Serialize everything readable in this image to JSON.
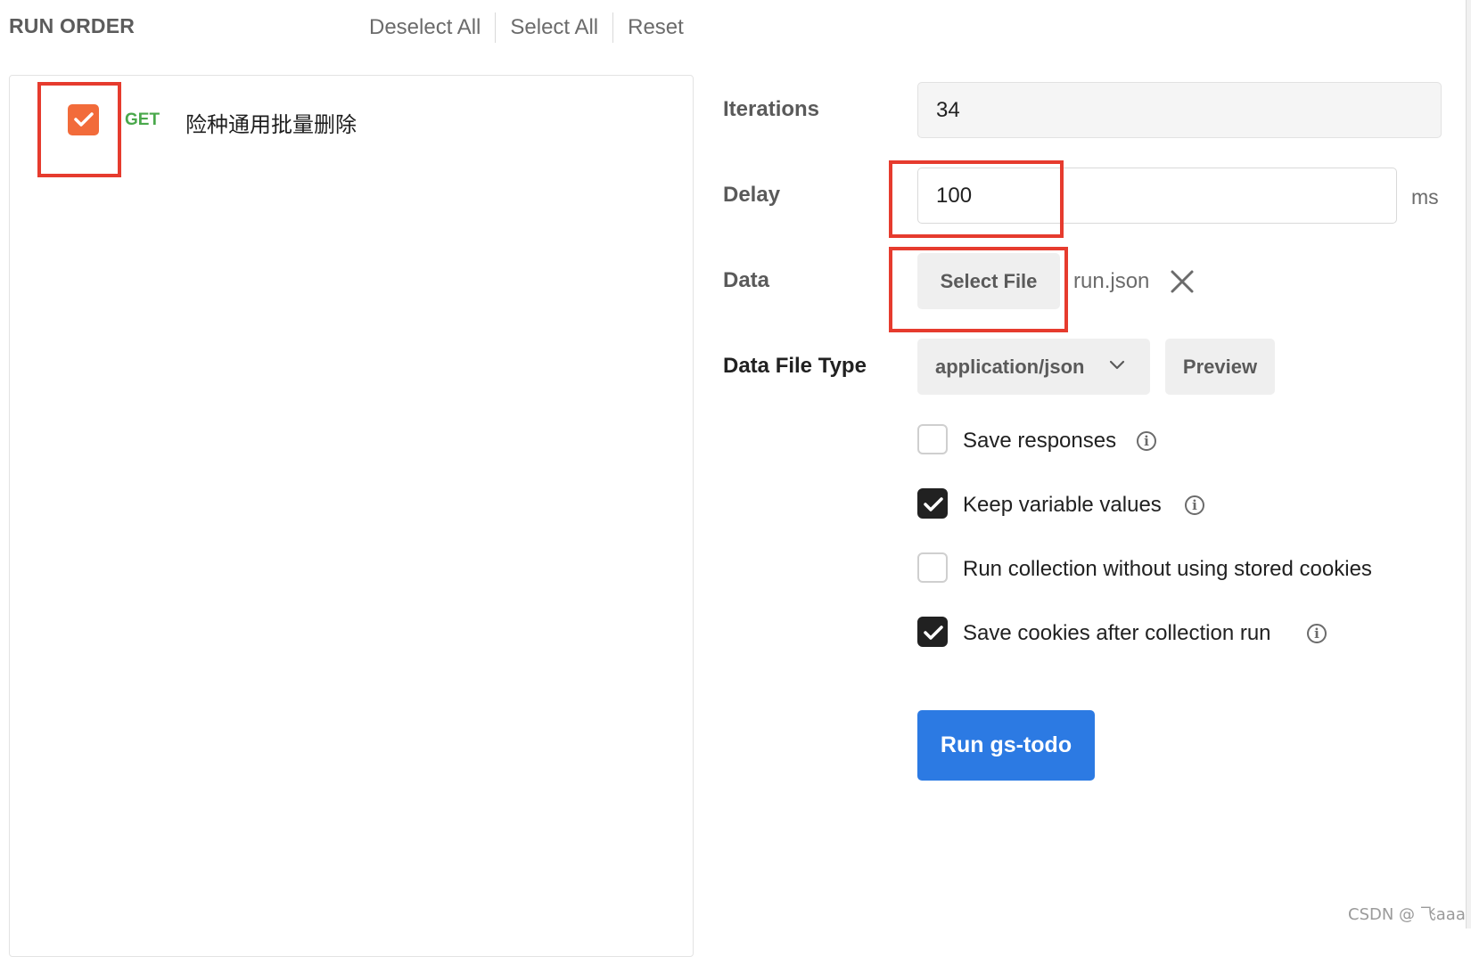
{
  "header": {
    "title": "RUN ORDER",
    "deselect_all": "Deselect All",
    "select_all": "Select All",
    "reset": "Reset"
  },
  "requests": [
    {
      "method": "GET",
      "name": "险种通用批量删除",
      "checked": true
    }
  ],
  "form": {
    "iterations_label": "Iterations",
    "iterations_value": "34",
    "delay_label": "Delay",
    "delay_value": "100",
    "delay_unit": "ms",
    "data_label": "Data",
    "select_file_label": "Select File",
    "file_name": "run.json",
    "data_file_type_label": "Data File Type",
    "data_file_type_value": "application/json",
    "preview_label": "Preview"
  },
  "options": [
    {
      "label": "Save responses",
      "checked": false,
      "has_info": true
    },
    {
      "label": "Keep variable values",
      "checked": true,
      "has_info": true
    },
    {
      "label": "Run collection without using stored cookies",
      "checked": false,
      "has_info": false
    },
    {
      "label": "Save cookies after collection run",
      "checked": true,
      "has_info": true
    }
  ],
  "run_button_label": "Run gs-todo",
  "watermark": "CSDN @ 飞aaa",
  "colors": {
    "accent_orange": "#f26b3a",
    "method_get_green": "#49a84b",
    "primary_blue": "#2c7ae3",
    "annotation_red": "#e63b2e"
  }
}
